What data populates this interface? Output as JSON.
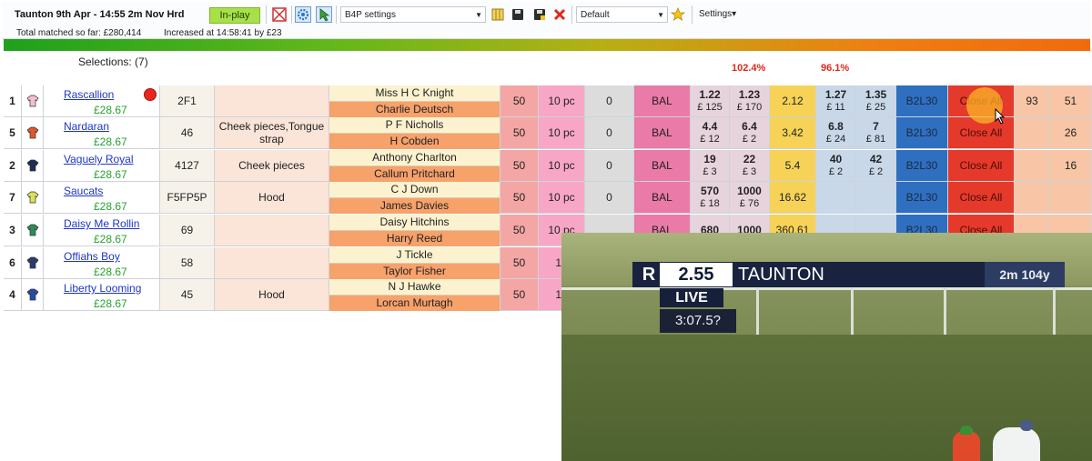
{
  "header": {
    "race_title": "Taunton 9th Apr - 14:55 2m Nov Hrd",
    "inplay_label": "In-play",
    "settings_select": "B4P settings",
    "view_select": "Default",
    "settings_menu": "Settings▾",
    "matched": "Total matched so far: £280,414",
    "increased": "Increased at 14:58:41 by £23"
  },
  "selections_label": "Selections: (7)",
  "book_percent_back": "102.4%",
  "book_percent_lay": "96.1%",
  "runners": [
    {
      "num": "1",
      "name_parts": [
        "Rascallion"
      ],
      "amount": "£28.67",
      "form": "2F1",
      "headgear": "",
      "jockey": "Miss H C Knight",
      "trainer": "Charlie Deutsch",
      "stake": "50",
      "pc": "10 pc",
      "zero": "0",
      "bal": "BAL",
      "back1": "1.22",
      "back1_amt": "£ 125",
      "back2": "1.23",
      "back2_amt": "£ 170",
      "mid": "2.12",
      "lay1": "1.27",
      "lay1_amt": "£ 11",
      "lay2": "1.35",
      "lay2_amt": "£ 25",
      "b2l": "B2L30",
      "close": "Close All",
      "x1": "93",
      "x2": "51",
      "silk_color": "#f3c0d2"
    },
    {
      "num": "5",
      "name_parts": [
        "Nardaran"
      ],
      "amount": "£28.67",
      "form": "46",
      "headgear": "Cheek pieces,Tongue strap",
      "jockey": "P F Nicholls",
      "trainer": "H Cobden",
      "stake": "50",
      "pc": "10 pc",
      "zero": "0",
      "bal": "BAL",
      "back1": "4.4",
      "back1_amt": "£ 12",
      "back2": "6.4",
      "back2_amt": "£ 2",
      "mid": "3.42",
      "lay1": "6.8",
      "lay1_amt": "£ 24",
      "lay2": "7",
      "lay2_amt": "£ 81",
      "b2l": "B2L30",
      "close": "Close All",
      "x1": "",
      "x2": "26",
      "silk_color": "#e2562b"
    },
    {
      "num": "2",
      "name_parts": [
        "Vaguely",
        "Royal"
      ],
      "amount": "£28.67",
      "form": "4127",
      "headgear": "Cheek pieces",
      "jockey": "Anthony Charlton",
      "trainer": "Callum Pritchard",
      "stake": "50",
      "pc": "10 pc",
      "zero": "0",
      "bal": "BAL",
      "back1": "19",
      "back1_amt": "£ 3",
      "back2": "22",
      "back2_amt": "£ 3",
      "mid": "5.4",
      "lay1": "40",
      "lay1_amt": "£ 2",
      "lay2": "42",
      "lay2_amt": "£ 2",
      "b2l": "B2L30",
      "close": "Close All",
      "x1": "",
      "x2": "16",
      "silk_color": "#1d2b55"
    },
    {
      "num": "7",
      "name_parts": [
        "Saucats"
      ],
      "amount": "£28.67",
      "form": "F5FP5P",
      "headgear": "Hood",
      "jockey": "C J Down",
      "trainer": "James Davies",
      "stake": "50",
      "pc": "10 pc",
      "zero": "0",
      "bal": "BAL",
      "back1": "570",
      "back1_amt": "£ 18",
      "back2": "1000",
      "back2_amt": "£ 76",
      "mid": "16.62",
      "lay1": "",
      "lay1_amt": "",
      "lay2": "",
      "lay2_amt": "",
      "b2l": "B2L30",
      "close": "Close All",
      "x1": "",
      "x2": "",
      "silk_color": "#d9e05a"
    },
    {
      "num": "3",
      "name_parts": [
        "Daisy",
        "Me",
        "Rollin"
      ],
      "amount": "£28.67",
      "form": "69",
      "headgear": "",
      "jockey": "Daisy Hitchins",
      "trainer": "Harry Reed",
      "stake": "50",
      "pc": "10 pc",
      "zero": "",
      "bal": "BAL",
      "back1": "680",
      "back1_amt": "",
      "back2": "1000",
      "back2_amt": "",
      "mid": "360.61",
      "lay1": "",
      "lay1_amt": "",
      "lay2": "",
      "lay2_amt": "",
      "b2l": "B2L30",
      "close": "Close All",
      "x1": "",
      "x2": "",
      "silk_color": "#2e8b57"
    },
    {
      "num": "6",
      "name_parts": [
        "Offiahs",
        "Boy"
      ],
      "amount": "£28.67",
      "form": "58",
      "headgear": "",
      "jockey": "J Tickle",
      "trainer": "Taylor Fisher",
      "stake": "50",
      "pc": "10",
      "zero": "",
      "bal": "",
      "back1": "",
      "back1_amt": "",
      "back2": "",
      "back2_amt": "",
      "mid": "",
      "lay1": "",
      "lay1_amt": "",
      "lay2": "",
      "lay2_amt": "",
      "b2l": "",
      "close": "",
      "x1": "",
      "x2": "",
      "silk_color": "#2a3b6d"
    },
    {
      "num": "4",
      "name_parts": [
        "Liberty",
        "Looming"
      ],
      "amount": "£28.67",
      "form": "45",
      "headgear": "Hood",
      "jockey": "N J Hawke",
      "trainer": "Lorcan Murtagh",
      "stake": "50",
      "pc": "10",
      "zero": "",
      "bal": "",
      "back1": "",
      "back1_amt": "",
      "back2": "",
      "back2_amt": "",
      "mid": "",
      "lay1": "",
      "lay1_amt": "",
      "lay2": "",
      "lay2_amt": "",
      "b2l": "",
      "close": "",
      "x1": "",
      "x2": "",
      "silk_color": "#274aa8"
    }
  ],
  "video": {
    "price": "2.55",
    "track": "TAUNTON",
    "distance": "2m 104y",
    "live": "LIVE",
    "clock": "3:07.5?"
  }
}
